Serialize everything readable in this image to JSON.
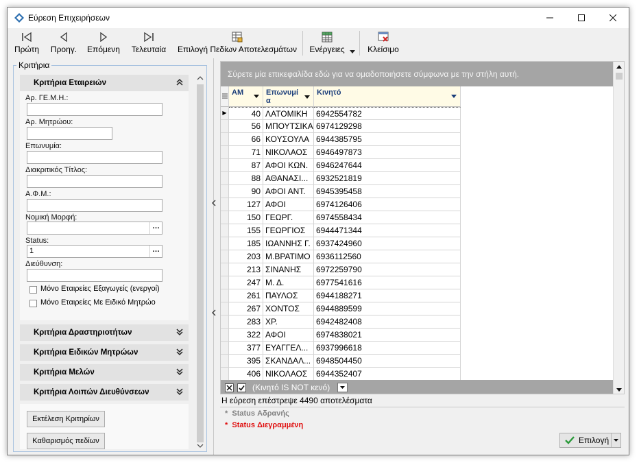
{
  "window": {
    "title": "Εύρεση Επιχειρήσεων"
  },
  "toolbar": {
    "first": "Πρώτη",
    "prev": "Προηγ.",
    "next": "Επόμενη",
    "last": "Τελευταία",
    "select_fields": "Επιλογή Πεδίων Αποτελεσμάτων",
    "actions": "Ενέργειες",
    "close": "Κλείσιμο"
  },
  "criteria": {
    "legend": "Κριτήρια",
    "company_group": "Κριτήρια Εταιρειών",
    "fields": {
      "gemi_label": "Αρ. ΓΕ.Μ.Η.:",
      "registry_label": "Αρ. Μητρώου:",
      "name_label": "Επωνυμία:",
      "title_label": "Διακριτικός Τίτλος:",
      "afm_label": "Α.Φ.Μ.:",
      "legal_form_label": "Νομική Μορφή:",
      "status_label": "Status:",
      "status_value": "1",
      "address_label": "Διεύθυνση:",
      "export_only": "Μόνο Εταιρείες Εξαγωγείς (ενεργοί)",
      "special_registry_only": "Μόνο Εταιρείες Με Ειδικό Μητρώο"
    },
    "collapsed_groups": [
      "Κριτήρια Δραστηριοτήτων",
      "Κριτήρια Ειδικών Μητρώων",
      "Κριτήρια Μελών",
      "Κριτήρια Λοιπών Διευθύνσεων"
    ],
    "run_button": "Εκτέλεση Κριτηρίων",
    "clear_button": "Καθαρισμός πεδίων"
  },
  "grid": {
    "group_hint": "Σύρετε μία επικεφαλίδα εδώ για να ομαδοποιήσετε σύμφωνα με την στήλη αυτή.",
    "columns": {
      "am": "ΑΜ",
      "name_line1": "Επωνυμί",
      "name_line2": "α",
      "phone": "Κινητό"
    },
    "rows": [
      {
        "am": "40",
        "name": "ΛΑΤΟΜΙΚΗ",
        "phone": "6942554782"
      },
      {
        "am": "56",
        "name": "ΜΠΟΥΤΣΙΚΑ",
        "phone": "6974129298"
      },
      {
        "am": "66",
        "name": "ΚΟΥΣΟΥΛΑ",
        "phone": "6944385795"
      },
      {
        "am": "71",
        "name": "ΝΙΚΟΛΑΟΣ",
        "phone": "6946497873"
      },
      {
        "am": "87",
        "name": "ΑΦΟΙ ΚΩΝ.",
        "phone": "6946247644"
      },
      {
        "am": "88",
        "name": "ΑΘΑΝΑΣΙ...",
        "phone": "6932521819"
      },
      {
        "am": "90",
        "name": "ΑΦΟΙ ΑΝΤ.",
        "phone": "6945395458"
      },
      {
        "am": "127",
        "name": "ΑΦΟΙ",
        "phone": "6974126406"
      },
      {
        "am": "150",
        "name": "ΓΕΩΡΓ.",
        "phone": "6974558434"
      },
      {
        "am": "155",
        "name": "ΓΕΩΡΓΙΟΣ",
        "phone": "6944471344"
      },
      {
        "am": "185",
        "name": "ΙΩΑΝΝΗΣ Γ.",
        "phone": "6937424960"
      },
      {
        "am": "203",
        "name": "Μ.ΒΡΑΤΙΜΟ",
        "phone": "6936112560"
      },
      {
        "am": "213",
        "name": "ΣΙΝΑΝΗΣ",
        "phone": "6972259790"
      },
      {
        "am": "247",
        "name": "Μ. Δ.",
        "phone": "6977541616"
      },
      {
        "am": "261",
        "name": "ΠΑΥΛΟΣ",
        "phone": "6944188271"
      },
      {
        "am": "267",
        "name": "ΧΟΝΤΟΣ",
        "phone": "6944889599"
      },
      {
        "am": "283",
        "name": "ΧΡ.",
        "phone": "6942482408"
      },
      {
        "am": "322",
        "name": "ΑΦΟΙ",
        "phone": "6974838021"
      },
      {
        "am": "377",
        "name": "ΕΥΑΓΓΕΛ...",
        "phone": "6937996618"
      },
      {
        "am": "395",
        "name": "ΣΚΑΝΔΑΛ...",
        "phone": "6948504450"
      },
      {
        "am": "406",
        "name": "ΝΙΚΟΛΑΟΣ",
        "phone": "6944352407"
      }
    ],
    "filter_text": "(Κινητό IS NOT κενό)"
  },
  "status": {
    "results": "Η εύρεση επέστρεψε 4490 αποτελέσματα",
    "legend_inactive": "Status Αδρανής",
    "legend_deleted": "Status Διεγραμμένη",
    "inactive_color": "#808080",
    "deleted_color": "#e01010"
  },
  "select_button": "Επιλογή"
}
